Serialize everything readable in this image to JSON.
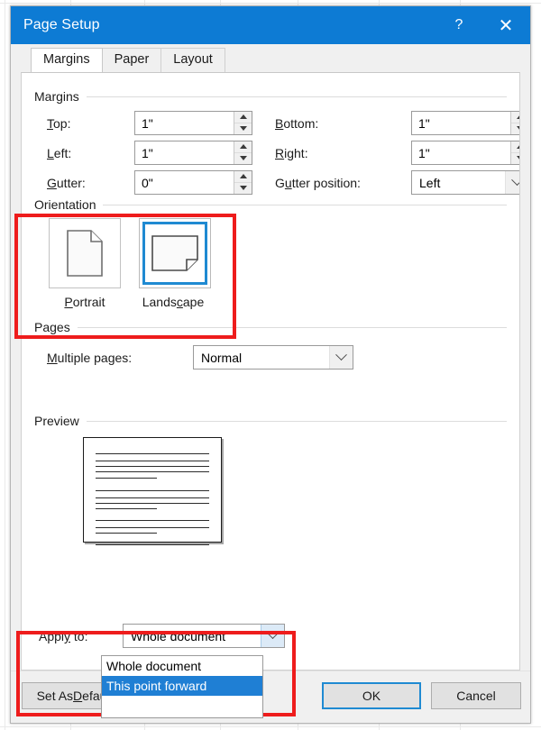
{
  "window": {
    "title": "Page Setup",
    "help_icon": "?",
    "help_icon_name": "help-icon",
    "close_icon": "✕",
    "accent_color": "#0d7bd4",
    "highlight_color": "#ee1c1c",
    "selection_color": "#1f8ad2"
  },
  "tabs": [
    {
      "label": "Margins",
      "active": true
    },
    {
      "label": "Paper",
      "active": false
    },
    {
      "label": "Layout",
      "active": false
    }
  ],
  "margins": {
    "group_label": "Margins",
    "top": {
      "label": "Top:",
      "accel": "T",
      "value": "1\""
    },
    "bottom": {
      "label": "Bottom:",
      "accel": "B",
      "value": "1\""
    },
    "left": {
      "label": "Left:",
      "accel": "L",
      "value": "1\""
    },
    "right": {
      "label": "Right:",
      "accel": "R",
      "value": "1\""
    },
    "gutter": {
      "label": "Gutter:",
      "accel": "G",
      "value": "0\""
    },
    "gutter_position": {
      "label": "Gutter position:",
      "accel": "u",
      "value": "Left"
    }
  },
  "orientation": {
    "group_label": "Orientation",
    "options": [
      {
        "label": "Portrait",
        "accel": "P",
        "selected": false,
        "icon": "portrait-page-icon"
      },
      {
        "label": "Landscape",
        "accel": "c",
        "selected": true,
        "icon": "landscape-page-icon"
      }
    ]
  },
  "pages": {
    "group_label": "Pages",
    "multiple_pages": {
      "label": "Multiple pages:",
      "accel": "M",
      "value": "Normal"
    }
  },
  "preview": {
    "group_label": "Preview",
    "page_orientation": "landscape"
  },
  "apply_to": {
    "label": "Apply to:",
    "accel": "y",
    "value": "Whole document",
    "expanded": true,
    "options": [
      {
        "label": "Whole document",
        "selected": false
      },
      {
        "label": "This point forward",
        "selected": true
      },
      {
        "label": "",
        "selected": false
      }
    ]
  },
  "buttons": {
    "set_as_default": {
      "label": "Set As Default",
      "accel": "D"
    },
    "ok": {
      "label": "OK",
      "default": true
    },
    "cancel": {
      "label": "Cancel",
      "default": false
    }
  }
}
